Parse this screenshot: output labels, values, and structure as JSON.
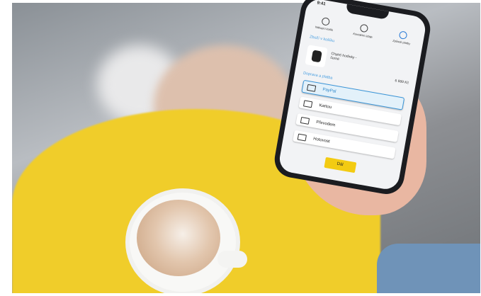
{
  "status_time": "9:41",
  "steps": [
    {
      "label": "Nákupní košík"
    },
    {
      "label": "Kontaktní údaje"
    },
    {
      "label": "Způsob platby"
    }
  ],
  "section_cart": "Zboží v košíku",
  "product": {
    "name": "Chytré hodinky - černé",
    "price": "6 999 Kč"
  },
  "section_payment": "Doprava a platba",
  "payment_options": [
    {
      "label": "PayPal"
    },
    {
      "label": "Kartou"
    },
    {
      "label": "Převodem"
    },
    {
      "label": "Hotovost"
    }
  ],
  "continue_label": "Dál",
  "colors": {
    "accent_blue": "#3a95d8",
    "button_yellow": "#f3cb12",
    "dress_yellow": "#f2cf2b"
  }
}
